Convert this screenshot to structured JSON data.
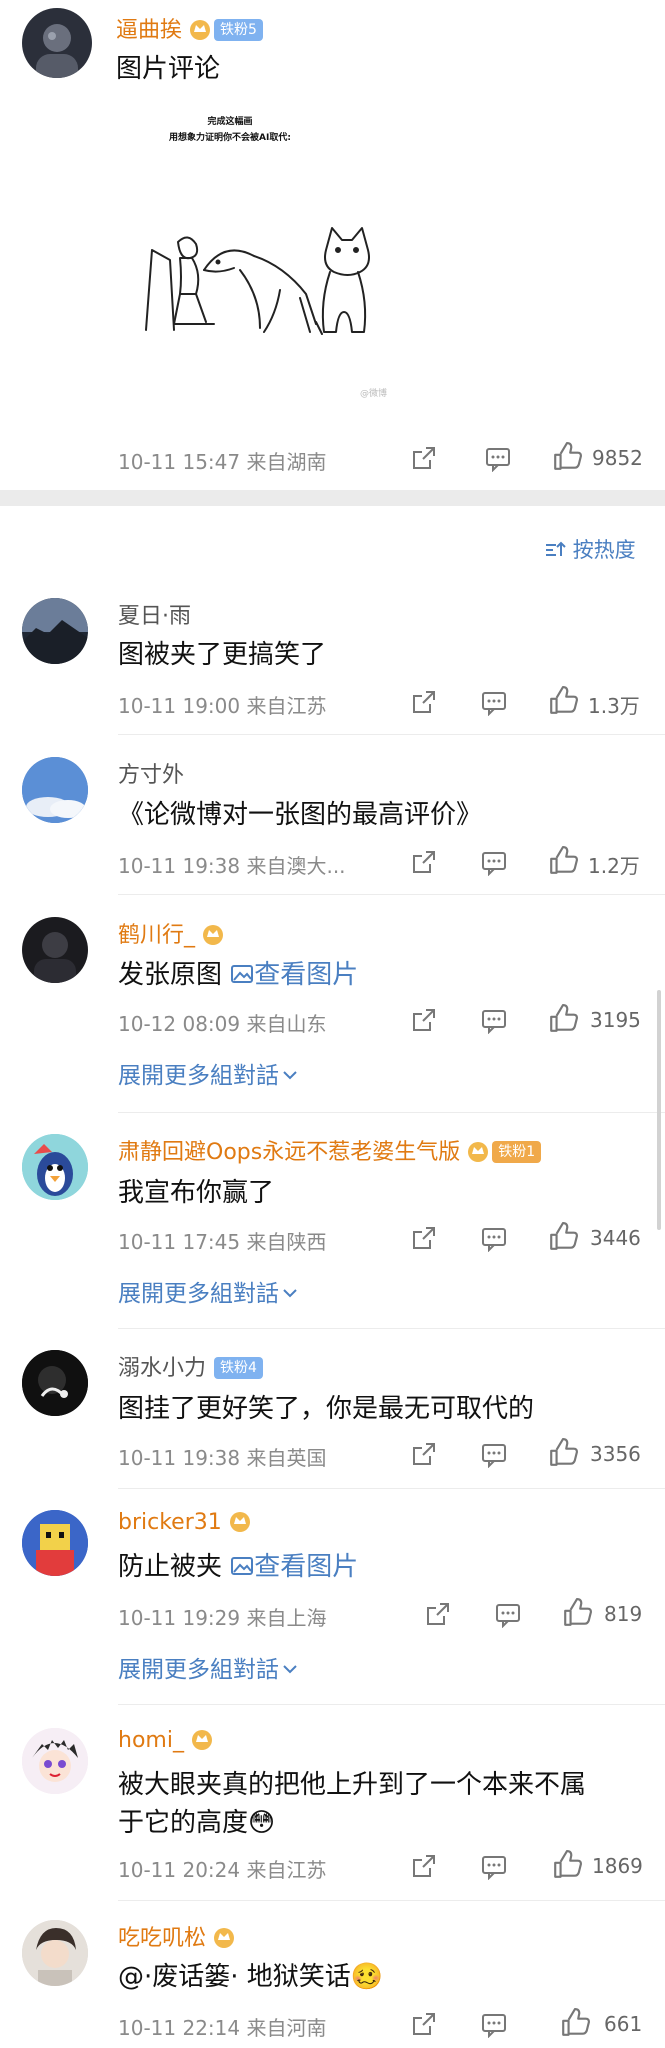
{
  "post": {
    "username": "逼曲挨",
    "fan_badge": "铁粉5",
    "text": "图片评论",
    "image_caption_title": "完成这幅画",
    "image_caption_sub": "用想象力证明你不会被AI取代:",
    "meta": "10-11 15:47  来自湖南",
    "likes": "9852"
  },
  "sort_label": "按热度",
  "view_image_label": "查看图片",
  "expand_label": "展開更多組對話",
  "comments": [
    {
      "username": "夏日·雨",
      "name_color": "gray",
      "crown": false,
      "badge": "",
      "text": "图被夹了更搞笑了",
      "meta": "10-11 19:00  来自江苏",
      "likes": "1.3万",
      "expand": false
    },
    {
      "username": "方寸外",
      "name_color": "gray",
      "crown": false,
      "badge": "",
      "text": "《论微博对一张图的最高评价》",
      "meta": "10-11 19:38  来自澳大...",
      "likes": "1.2万",
      "expand": false
    },
    {
      "username": "鹤川行_",
      "name_color": "gold",
      "crown": true,
      "badge": "",
      "text": "发张原图",
      "meta": "10-12 08:09  来自山东",
      "likes": "3195",
      "expand": true
    },
    {
      "username": "肃静回避Oops永远不惹老婆生气版",
      "name_color": "gold",
      "crown": true,
      "badge": "铁粉1",
      "text": "我宣布你赢了",
      "meta": "10-11 17:45  来自陕西",
      "likes": "3446",
      "expand": true
    },
    {
      "username": "溺水小力",
      "name_color": "gray",
      "crown": false,
      "badge": "铁粉4",
      "text": "图挂了更好笑了，你是最无可取代的",
      "meta": "10-11 19:38  来自英国",
      "likes": "3356",
      "expand": false
    },
    {
      "username": "bricker31",
      "name_color": "gold",
      "crown": true,
      "badge": "",
      "text": "防止被夹",
      "meta": "10-11 19:29  来自上海",
      "likes": "819",
      "expand": true
    },
    {
      "username": "homi_",
      "name_color": "gold",
      "crown": true,
      "badge": "",
      "text": "被大眼夹真的把他上升到了一个本来不属",
      "text2": "于它的高度😳",
      "meta": "10-11 20:24  来自江苏",
      "likes": "1869",
      "expand": false
    },
    {
      "username": "吃吃叽松",
      "name_color": "gold",
      "crown": true,
      "badge": "",
      "text": "@·废话篓· 地狱笑话🥴",
      "meta": "10-11 22:14  来自河南",
      "likes": "661",
      "expand": false
    }
  ]
}
